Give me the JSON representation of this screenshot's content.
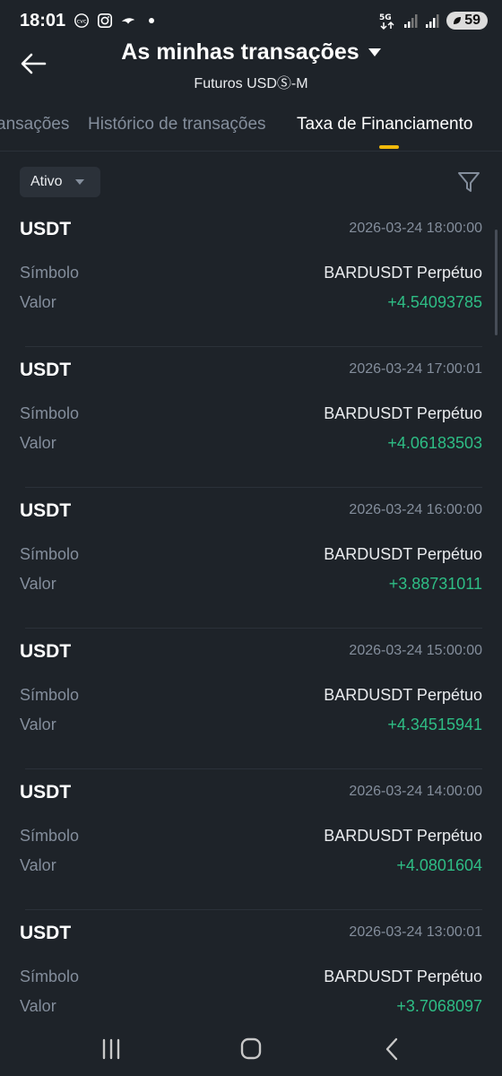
{
  "status_bar": {
    "time": "18:01",
    "left_icons": [
      "cvc-icon",
      "instagram-icon",
      "airline-icon",
      "notification-dot"
    ],
    "network": "5G",
    "battery": "59"
  },
  "header": {
    "title": "As minhas transações",
    "subtitle": "Futuros USDⓈ-M"
  },
  "tabs": [
    {
      "label": "ansações",
      "active": false
    },
    {
      "label": "Histórico de transações",
      "active": false
    },
    {
      "label": "Taxa de Financiamento",
      "active": true
    }
  ],
  "filter": {
    "status_label": "Ativo"
  },
  "labels": {
    "symbol": "Símbolo",
    "value": "Valor"
  },
  "transactions": [
    {
      "currency": "USDT",
      "timestamp": "2026-03-24 18:00:00",
      "symbol": "BARDUSDT Perpétuo",
      "value": "+4.54093785"
    },
    {
      "currency": "USDT",
      "timestamp": "2026-03-24 17:00:01",
      "symbol": "BARDUSDT Perpétuo",
      "value": "+4.06183503"
    },
    {
      "currency": "USDT",
      "timestamp": "2026-03-24 16:00:00",
      "symbol": "BARDUSDT Perpétuo",
      "value": "+3.88731011"
    },
    {
      "currency": "USDT",
      "timestamp": "2026-03-24 15:00:00",
      "symbol": "BARDUSDT Perpétuo",
      "value": "+4.34515941"
    },
    {
      "currency": "USDT",
      "timestamp": "2026-03-24 14:00:00",
      "symbol": "BARDUSDT Perpétuo",
      "value": "+4.0801604"
    },
    {
      "currency": "USDT",
      "timestamp": "2026-03-24 13:00:01",
      "symbol": "BARDUSDT Perpétuo",
      "value": "+3.7068097"
    }
  ],
  "colors": {
    "background": "#1e2329",
    "accent": "#f0b90b",
    "positive": "#2ebd85",
    "muted": "#848e9c"
  }
}
